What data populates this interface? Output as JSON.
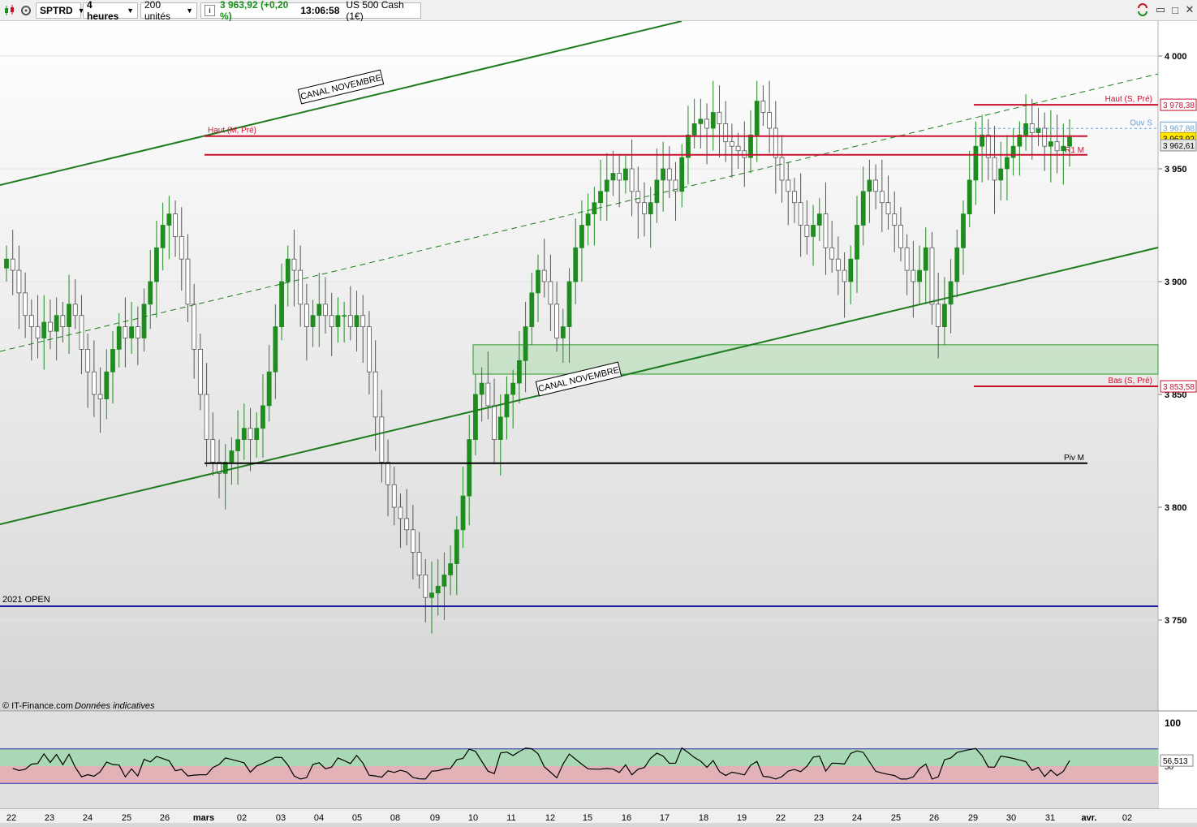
{
  "toolbar": {
    "symbol": "SPTRD",
    "timeframe": "4 heures",
    "quantity": "200 unités",
    "info_icon": "info-icon",
    "last_price": "3 963,92 (+0,20 %)",
    "time": "13:06:58",
    "instrument": "US 500 Cash (1€)"
  },
  "window": {
    "minimize": "▭",
    "maximize": "□",
    "close": "✕"
  },
  "labels": {
    "copyright": "© IT-Finance.com",
    "disclaimer": "Données indicatives",
    "open_2021": "2021 OPEN",
    "canal_top": "CANAL NOVEMBRE",
    "canal_bottom": "CANAL NOVEMBRE",
    "haut_m": "Haut (M, Pré)",
    "haut_s": "Haut (S, Pré)",
    "ouv_s": "Ouv S",
    "r1_m": "R1 M",
    "bas_s": "Bas (S, Pré)",
    "piv_m": "Piv M"
  },
  "colors": {
    "up": "#1e8c1e",
    "down": "#ffffff",
    "levels": "#c8102e",
    "channel": "#1e7b1e",
    "open_line": "#1a1aa0",
    "pivot": "#000000"
  },
  "chart_data": {
    "type": "candlestick",
    "y_ticks": [
      "4 000",
      "3 950",
      "3 900",
      "3 850",
      "3 800",
      "3 750"
    ],
    "y_tick_values": [
      4000,
      3950,
      3900,
      3850,
      3800,
      3750
    ],
    "x_labels": [
      "22",
      "23",
      "24",
      "25",
      "26",
      "mars",
      "02",
      "03",
      "04",
      "05",
      "08",
      "09",
      "10",
      "11",
      "12",
      "15",
      "16",
      "17",
      "18",
      "19",
      "22",
      "23",
      "24",
      "25",
      "26",
      "29",
      "30",
      "31",
      "avr.",
      "02"
    ],
    "price_tags": [
      {
        "text": "3 978,38",
        "value": 3978.38,
        "style": "red"
      },
      {
        "text": "3 967,88",
        "value": 3967.88,
        "style": "blue"
      },
      {
        "text": "3 963,92",
        "value": 3963.92,
        "style": "yellow"
      },
      {
        "text": "3 962,61",
        "value": 3962.61,
        "style": "gray"
      },
      {
        "text": "3 853,58",
        "value": 3853.58,
        "style": "red"
      }
    ],
    "levels": {
      "haut_m_pre": 3964.5,
      "r1_m": 3956.2,
      "haut_s_pre": 3978.38,
      "ouv_s": 3967.88,
      "bas_s_pre": 3853.58,
      "piv_m": 3819.5,
      "open_2021": 3756.1
    },
    "support_zone": [
      3859,
      3872
    ],
    "close_series": [
      3910,
      3905,
      3895,
      3885,
      3880,
      3875,
      3882,
      3878,
      3885,
      3880,
      3890,
      3885,
      3870,
      3860,
      3850,
      3848,
      3860,
      3870,
      3880,
      3875,
      3880,
      3875,
      3890,
      3900,
      3915,
      3925,
      3930,
      3920,
      3910,
      3890,
      3870,
      3850,
      3830,
      3820,
      3815,
      3820,
      3825,
      3830,
      3835,
      3830,
      3835,
      3845,
      3860,
      3880,
      3900,
      3910,
      3905,
      3890,
      3880,
      3885,
      3890,
      3885,
      3880,
      3885,
      3885,
      3880,
      3885,
      3880,
      3860,
      3840,
      3820,
      3810,
      3800,
      3795,
      3790,
      3780,
      3770,
      3760,
      3762,
      3765,
      3770,
      3775,
      3790,
      3805,
      3830,
      3850,
      3855,
      3845,
      3830,
      3840,
      3850,
      3855,
      3865,
      3880,
      3895,
      3905,
      3900,
      3890,
      3875,
      3880,
      3900,
      3915,
      3925,
      3930,
      3935,
      3940,
      3945,
      3948,
      3945,
      3950,
      3940,
      3935,
      3930,
      3935,
      3945,
      3950,
      3945,
      3940,
      3955,
      3965,
      3970,
      3972,
      3968,
      3975,
      3970,
      3962,
      3960,
      3958,
      3955,
      3965,
      3980,
      3975,
      3968,
      3955,
      3945,
      3940,
      3935,
      3925,
      3920,
      3925,
      3930,
      3915,
      3910,
      3905,
      3900,
      3910,
      3925,
      3940,
      3945,
      3940,
      3935,
      3930,
      3925,
      3915,
      3905,
      3900,
      3905,
      3915,
      3890,
      3880,
      3890,
      3900,
      3915,
      3930,
      3945,
      3960,
      3965,
      3955,
      3945,
      3950,
      3955,
      3960,
      3965,
      3970,
      3966,
      3968,
      3960,
      3962,
      3958,
      3960,
      3963.92
    ],
    "rsi": {
      "axis_labels": [
        "100",
        "50"
      ],
      "axis_values": [
        100,
        50
      ],
      "upper_band": 70,
      "lower_band": 30,
      "last_value_text": "56,513",
      "last_value": 56.513
    }
  }
}
